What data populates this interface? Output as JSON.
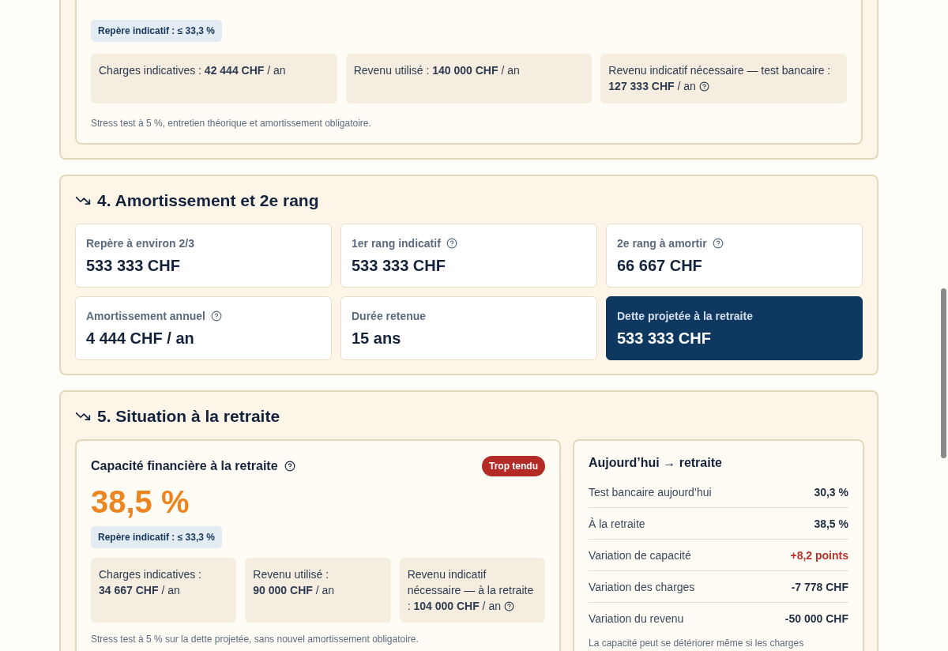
{
  "budget_card": {
    "benchmark": "Repère indicatif : ≤ 33,3 %",
    "facts": [
      {
        "label": "Charges indicatives :",
        "value": "42 444 CHF",
        "unit": "/ an",
        "help": false
      },
      {
        "label": "Revenu utilisé :",
        "value": "140 000 CHF",
        "unit": "/ an",
        "help": false
      },
      {
        "label": "Revenu indicatif nécessaire — test bancaire :",
        "value": "127 333 CHF",
        "unit": "/ an",
        "help": true
      }
    ],
    "note": "Stress test à 5 %, entretien théorique et amortissement obligatoire."
  },
  "amortization": {
    "title": "4. Amortissement et 2e rang",
    "tiles": [
      {
        "label": "Repère à environ 2/3",
        "value": "533 333 CHF",
        "help": false,
        "highlighted": false
      },
      {
        "label": "1er rang indicatif",
        "value": "533 333 CHF",
        "help": true,
        "highlighted": false
      },
      {
        "label": "2e rang à amortir",
        "value": "66 667 CHF",
        "help": true,
        "highlighted": false
      },
      {
        "label": "Amortissement annuel",
        "value": "4 444 CHF / an",
        "help": true,
        "highlighted": false
      },
      {
        "label": "Durée retenue",
        "value": "15 ans",
        "help": false,
        "highlighted": false
      },
      {
        "label": "Dette projetée à la retraite",
        "value": "533 333 CHF",
        "help": false,
        "highlighted": true
      }
    ]
  },
  "retirement": {
    "title": "5. Situation à la retraite",
    "capacity": {
      "title": "Capacité financière à la retraite",
      "status": "Trop tendu",
      "value": "38,5 %",
      "benchmark": "Repère indicatif : ≤ 33,3 %",
      "facts": [
        {
          "label": "Charges indicatives :",
          "value": "34 667 CHF",
          "unit": "/ an",
          "help": false
        },
        {
          "label": "Revenu utilisé :",
          "value": "90 000 CHF",
          "unit": "/ an",
          "help": false
        },
        {
          "label": "Revenu indicatif nécessaire — à la retraite :",
          "value": "104 000 CHF",
          "unit": "/ an",
          "help": true
        }
      ],
      "note": "Stress test à 5 % sur la dette projetée, sans nouvel amortissement obligatoire."
    },
    "comparison": {
      "title": "Aujourd’hui → retraite",
      "rows": [
        {
          "label": "Test bancaire aujourd’hui",
          "value": "30,3 %",
          "color": "#1f2d42"
        },
        {
          "label": "À la retraite",
          "value": "38,5 %",
          "color": "#1f2d42"
        },
        {
          "label": "Variation de capacité",
          "value": "+8,2 points",
          "color": "#c0302a"
        },
        {
          "label": "Variation des charges",
          "value": "-7 778 CHF",
          "color": "#1f2d42"
        },
        {
          "label": "Variation du revenu",
          "value": "-50 000 CHF",
          "color": "#1f2d42"
        }
      ],
      "note": "La capacité peut se détériorer même si les charges"
    }
  }
}
